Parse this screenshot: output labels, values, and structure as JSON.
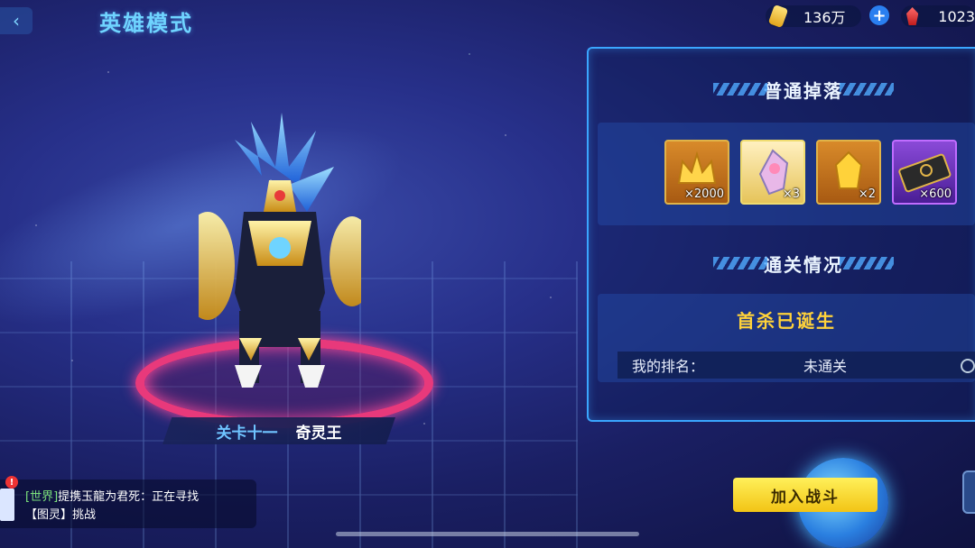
{
  "header": {
    "back_icon": "chevron-left-icon",
    "title": "英雄模式",
    "gold_amount": "136万",
    "gem_amount": "1023"
  },
  "stage": {
    "number": "关卡十一",
    "boss_name": "奇灵王"
  },
  "drops": {
    "title": "普通掉落",
    "items": [
      {
        "icon": "crown-icon",
        "count": "×2000",
        "frame": "#e0b348"
      },
      {
        "icon": "crystal-icon",
        "count": "×3",
        "frame": "#f0dc70"
      },
      {
        "icon": "gold-gem-icon",
        "count": "×2",
        "frame": "#e0b348"
      },
      {
        "icon": "ticket-icon",
        "count": "×600",
        "frame": "#c06cff"
      }
    ]
  },
  "clear_status": {
    "title": "通关情况",
    "first_kill": "首杀已诞生",
    "rank_label": "我的排名：",
    "rank_value": "未通关"
  },
  "chat": {
    "channel": "[世界]",
    "line1_text": "提携玉龍为君死：正在寻找",
    "line2_text": "【图灵】挑战"
  },
  "join_button": "加入战斗"
}
